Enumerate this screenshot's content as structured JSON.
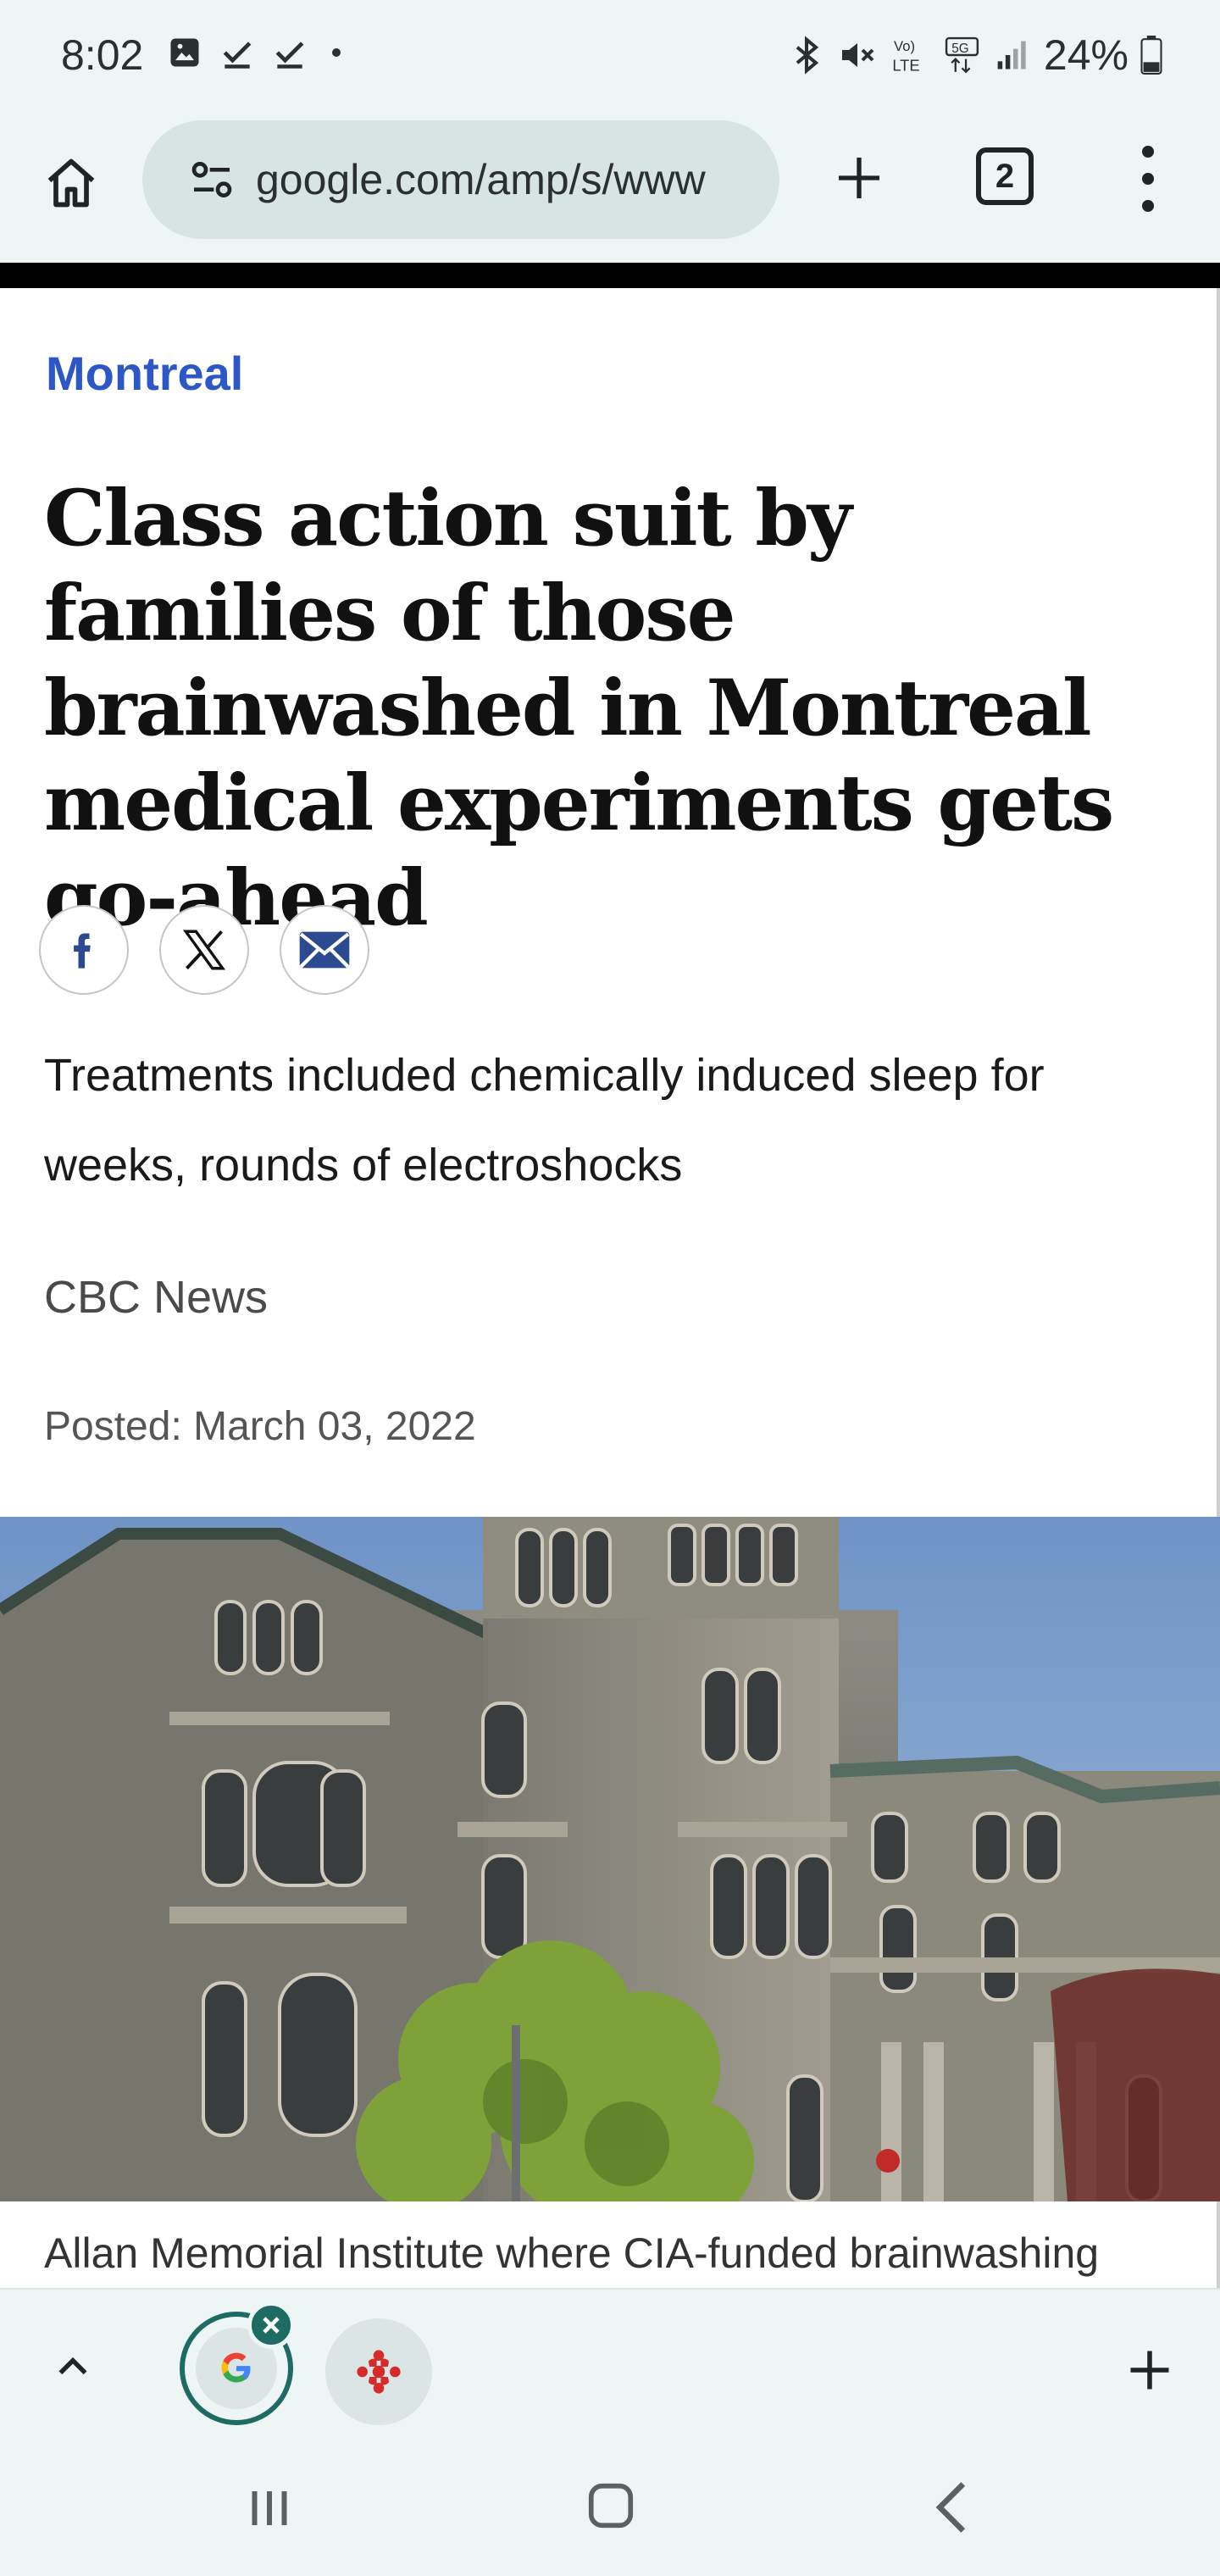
{
  "status_bar": {
    "time": "8:02",
    "left_icons": [
      "gallery-icon",
      "check-icon",
      "check-icon",
      "dot-icon"
    ],
    "right_icons": [
      "bluetooth-icon",
      "mute-icon",
      "volte-icon",
      "5g-icon",
      "signal-icon"
    ],
    "network_lte_label": "LTE",
    "network_5g_label": "5G",
    "battery_text": "24%"
  },
  "browser": {
    "url": "google.com/amp/s/www",
    "tab_count": "2",
    "home_icon": "home-icon",
    "site_info_icon": "tune-icon",
    "new_tab_icon": "plus-icon",
    "menu_icon": "more-vert-icon"
  },
  "article": {
    "section": "Montreal",
    "headline": "Class action suit by families of those brainwashed in Montreal medical experiments gets go-ahead",
    "share": [
      "facebook-icon",
      "x-icon",
      "email-icon"
    ],
    "deck": "Treatments included chemically induced sleep for weeks, rounds of electroshocks",
    "byline": "CBC News",
    "posted": "Posted: March 03, 2022",
    "photo_caption": "Allan Memorial Institute where CIA-funded brainwashing"
  },
  "tab_strip": {
    "collapse_icon": "chevron-up-icon",
    "tabs": [
      {
        "icon": "google-icon",
        "active": true,
        "close_icon": "close-icon"
      },
      {
        "icon": "cbc-icon",
        "active": false
      }
    ],
    "new_tab_icon": "plus-icon"
  },
  "nav_bar": {
    "buttons": [
      "recents-icon",
      "home-nav-icon",
      "back-icon"
    ]
  },
  "colors": {
    "chrome_bg": "#eef5f5",
    "omnibox_bg": "#d7e4e4",
    "section_blue": "#2d56c7",
    "active_tab_green": "#1e6b63"
  }
}
